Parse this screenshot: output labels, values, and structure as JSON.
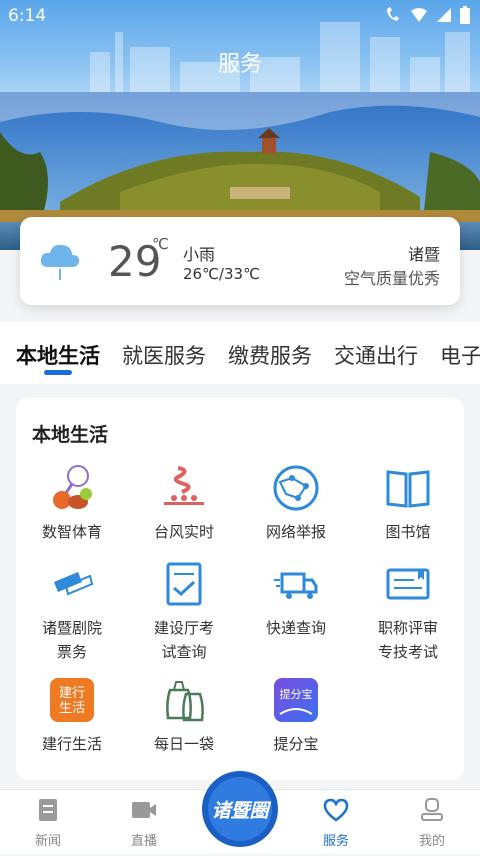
{
  "status": {
    "time": "6:14"
  },
  "header": {
    "title": "服务"
  },
  "weather": {
    "icon": "cloud-rain-icon",
    "temp": "29",
    "unit": "℃",
    "condition": "小雨",
    "range": "26℃/33℃",
    "city": "诸暨",
    "air_quality": "空气质量优秀"
  },
  "tabs": [
    {
      "label": "本地生活",
      "active": true
    },
    {
      "label": "就医服务"
    },
    {
      "label": "缴费服务"
    },
    {
      "label": "交通出行"
    },
    {
      "label": "电子"
    }
  ],
  "panel": {
    "title": "本地生活",
    "items": [
      {
        "label": "数智体育",
        "icon": "sports-balls-icon"
      },
      {
        "label": "台风实时",
        "icon": "typhoon-icon"
      },
      {
        "label": "网络举报",
        "icon": "network-globe-icon"
      },
      {
        "label": "图书馆",
        "icon": "open-book-icon"
      },
      {
        "label": "诸暨剧院\n票务",
        "icon": "theater-tickets-icon"
      },
      {
        "label": "建设厅考\n试查询",
        "icon": "document-check-icon"
      },
      {
        "label": "快递查询",
        "icon": "delivery-truck-icon"
      },
      {
        "label": "职称评审\n专技考试",
        "icon": "certificate-icon"
      },
      {
        "label": "建行生活",
        "icon": "ccb-life-icon",
        "badge": "建行\n生活"
      },
      {
        "label": "每日一袋",
        "icon": "recycle-bag-icon"
      },
      {
        "label": "提分宝",
        "icon": "tifenbao-icon",
        "badge": "提分宝"
      }
    ]
  },
  "bottom_nav": {
    "items": [
      {
        "label": "新闻",
        "icon": "news-icon"
      },
      {
        "label": "直播",
        "icon": "video-icon"
      },
      {
        "label": "服务",
        "icon": "heart-icon",
        "active": true
      },
      {
        "label": "我的",
        "icon": "profile-icon"
      }
    ],
    "center_logo": "诸暨圈"
  },
  "colors": {
    "accent": "#1a6fd6",
    "icon_blue": "#2f8ad8",
    "icon_orange": "#e86a2a"
  }
}
